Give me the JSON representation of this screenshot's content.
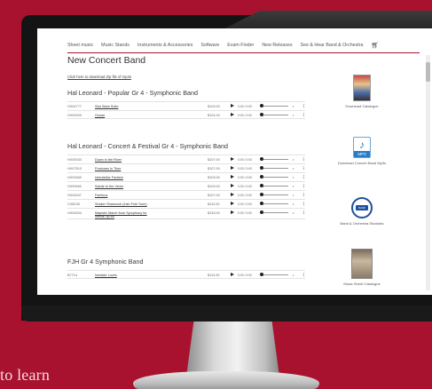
{
  "nav": {
    "items": [
      "Sheet music",
      "Music Stands",
      "Instruments & Accessories",
      "Software",
      "Exam Finder",
      "New Releases",
      "See & Hear Band & Orchestra"
    ],
    "cart_icon": "cart-icon"
  },
  "page": {
    "title": "New Concert Band",
    "download_link": "Click here to download Zip file of mp3s"
  },
  "sections": [
    {
      "title": "Hal Leonard - Popular Gr 4 - Symphonic Band",
      "tracks": [
        {
          "code": "HX04777",
          "title": "Star Wars Suite",
          "price": "$103.00",
          "time": "0:00 / 0:00"
        },
        {
          "code": "HX00009",
          "title": "Ocean",
          "price": "$124.00",
          "time": "0:00 / 0:00"
        }
      ]
    },
    {
      "title": "Hal Leonard - Concert & Festival Gr 4 - Symphonic Band",
      "tracks": [
        {
          "code": "HX00030",
          "title": "Down in the River",
          "price": "$107.00",
          "time": "0:00 / 0:00"
        },
        {
          "code": "HX07510",
          "title": "Fractures in Time",
          "price": "$107.00",
          "time": "0:00 / 0:00"
        },
        {
          "code": "HX03460",
          "title": "Interstellar Fanfare",
          "price": "$103.00",
          "time": "0:00 / 0:00"
        },
        {
          "code": "HX99460",
          "title": "Salute to the Victor",
          "price": "$103.00",
          "time": "0:00 / 0:00"
        },
        {
          "code": "HX03047",
          "title": "Fanticus",
          "price": "$107.00",
          "time": "0:00 / 0:00"
        },
        {
          "code": "CXB130",
          "title": "Shaker Shamrock (Irish Folk Tune)",
          "price": "$114.00",
          "time": "0:00 / 0:00"
        },
        {
          "code": "HX04004",
          "title": "Majestic March from Symphony for Winds Op.80",
          "price": "$133.00",
          "time": "0:00 / 0:00"
        }
      ]
    },
    {
      "title": "FJH Gr 4 Symphonic Band",
      "tracks": [
        {
          "code": "B7714",
          "title": "Imbalde Loves",
          "price": "$113.00",
          "time": "0:00 / 0:00"
        }
      ]
    }
  ],
  "sidebar": [
    {
      "caption": "Download Catalogue",
      "icon": "catalogue-icon"
    },
    {
      "caption": "Download Concert Band Mp3s",
      "icon": "mp3-icon"
    },
    {
      "caption": "Band & Orchestra Stockists",
      "icon": "stockists-icon"
    },
    {
      "caption": "Music Sheet Catalogue",
      "icon": "sheet-catalogue-icon"
    }
  ],
  "mp3_label": "MP3",
  "stock_badge": "BAND",
  "background_text": "to learn",
  "colors": {
    "brand": "#a8122e",
    "monitor": "#141414",
    "screen": "#ffffff"
  }
}
